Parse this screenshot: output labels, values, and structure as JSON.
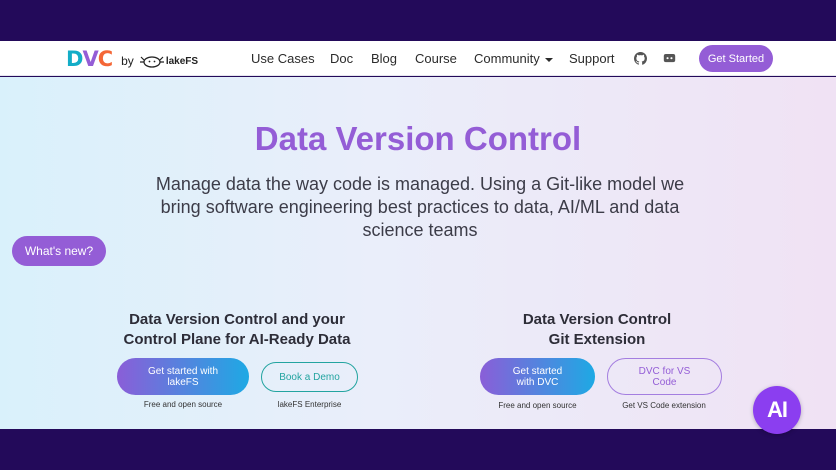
{
  "brand": {
    "logo_d": "D",
    "logo_v": "V",
    "logo_c": "C",
    "by": "by",
    "partner": "lakeFS"
  },
  "nav": {
    "use_cases": "Use Cases",
    "doc": "Doc",
    "blog": "Blog",
    "course": "Course",
    "community": "Community",
    "support": "Support",
    "github_icon": "github-icon",
    "discord_icon": "discord-icon",
    "get_started": "Get Started"
  },
  "hero": {
    "title": "Data Version Control",
    "subtitle": "Manage data the way code is managed. Using a Git-like model we bring software engineering best practices to data, AI/ML and data science teams"
  },
  "whats_new": "What's new?",
  "left_column": {
    "title_line1": "Data Version Control and your",
    "title_line2": "Control Plane for AI-Ready Data",
    "primary_button": "Get started with lakeFS",
    "primary_caption": "Free and open source",
    "secondary_button": "Book a Demo",
    "secondary_caption": "lakeFS Enterprise"
  },
  "right_column": {
    "title_line1": "Data Version Control",
    "title_line2": "Git Extension",
    "primary_button": "Get started with DVC",
    "primary_caption": "Free and open source",
    "secondary_button": "DVC for VS Code",
    "secondary_caption": "Get VS Code extension"
  },
  "ai_badge": "AI",
  "colors": {
    "band": "#230a5a",
    "accent_purple": "#945dd6",
    "accent_teal": "#23a4a0",
    "logo_blue": "#13adc7",
    "logo_orange": "#f46737"
  }
}
